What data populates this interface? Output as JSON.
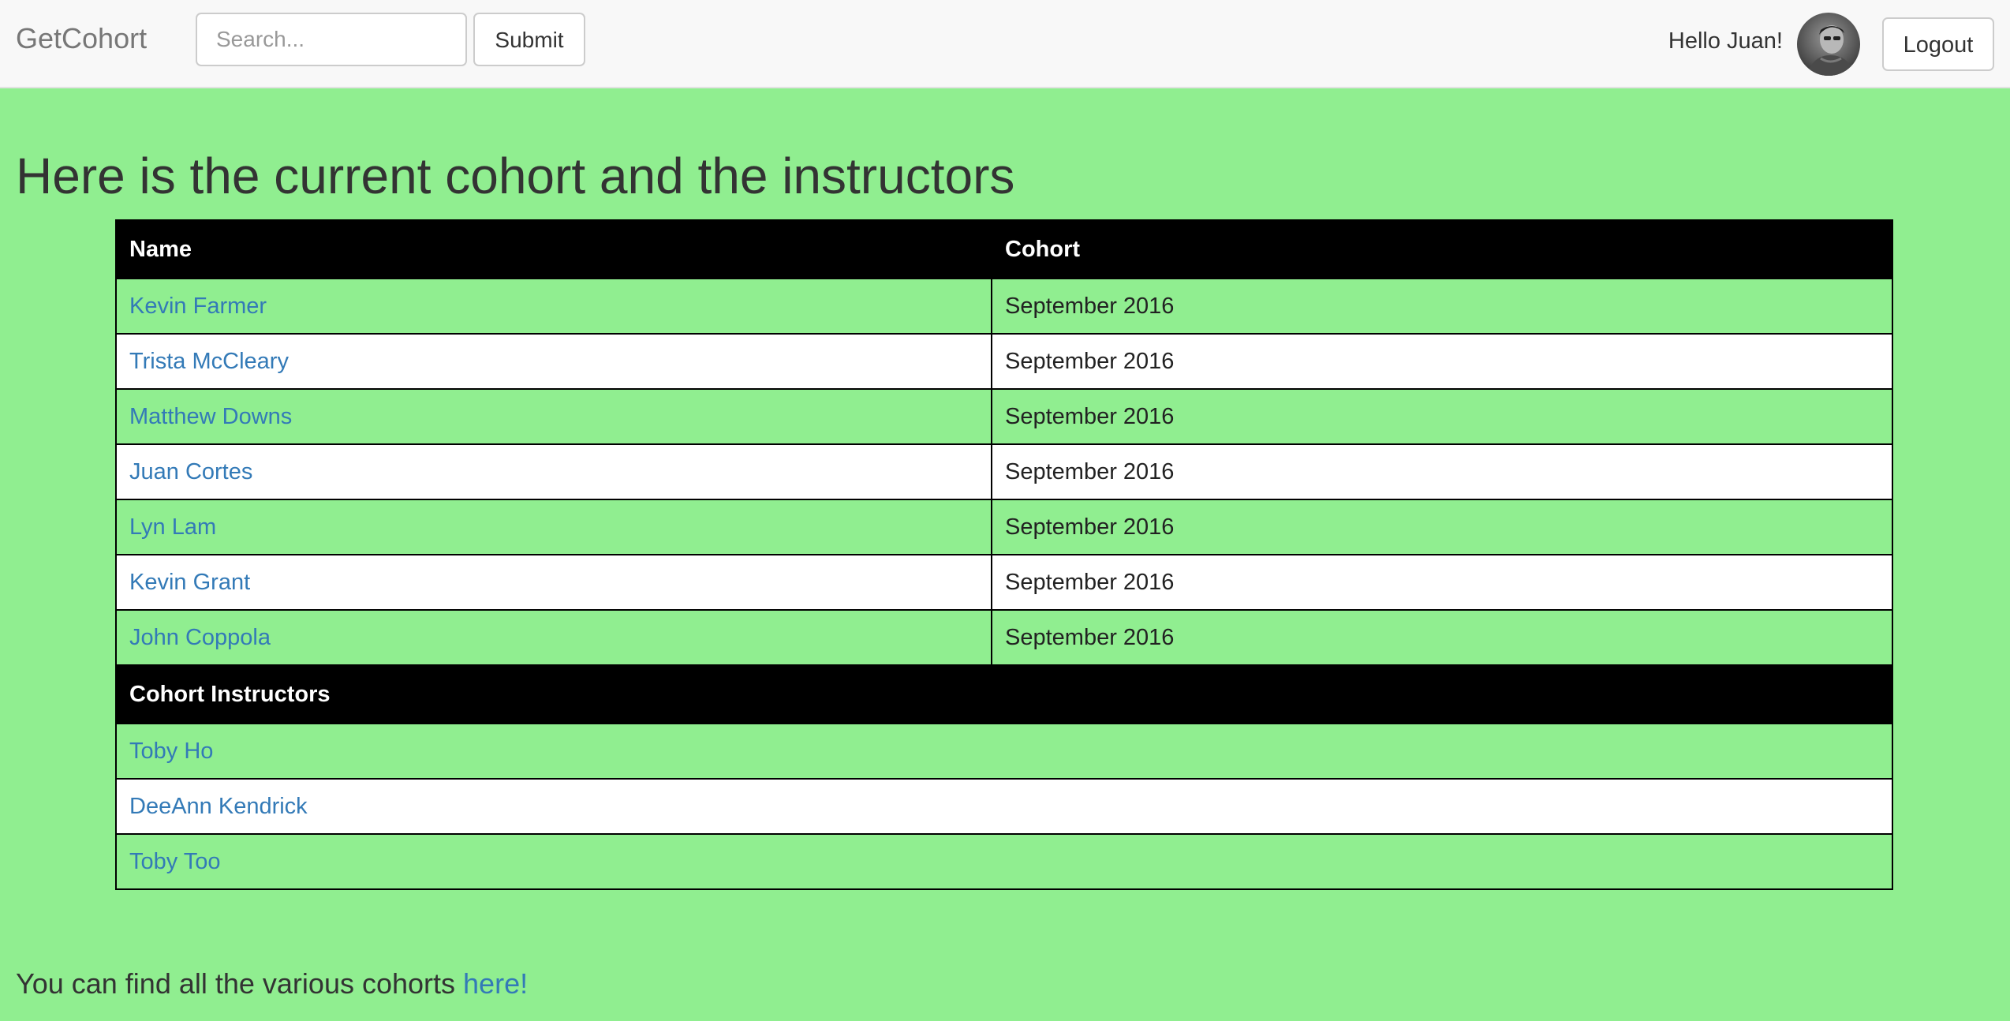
{
  "navbar": {
    "brand": "GetCohort",
    "search_placeholder": "Search...",
    "submit_label": "Submit",
    "greeting": "Hello Juan!",
    "logout_label": "Logout"
  },
  "main": {
    "heading": "Here is the current cohort and the instructors",
    "table": {
      "headers": [
        "Name",
        "Cohort"
      ],
      "rows": [
        {
          "name": "Kevin Farmer",
          "cohort": "September 2016"
        },
        {
          "name": "Trista McCleary",
          "cohort": "September 2016"
        },
        {
          "name": "Matthew Downs",
          "cohort": "September 2016"
        },
        {
          "name": "Juan Cortes",
          "cohort": "September 2016"
        },
        {
          "name": "Lyn Lam",
          "cohort": "September 2016"
        },
        {
          "name": "Kevin Grant",
          "cohort": "September 2016"
        },
        {
          "name": "John Coppola",
          "cohort": "September 2016"
        }
      ],
      "instructors_header": "Cohort Instructors",
      "instructors": [
        "Toby Ho",
        "DeeAnn Kendrick",
        "Toby Too"
      ]
    },
    "footer_text": "You can find all the various cohorts ",
    "footer_link": "here!"
  },
  "colors": {
    "page_background": "#90ee90",
    "link": "#337ab7",
    "table_header": "#000000",
    "navbar": "#f8f8f8"
  },
  "icons": {
    "avatar": "user-avatar"
  }
}
